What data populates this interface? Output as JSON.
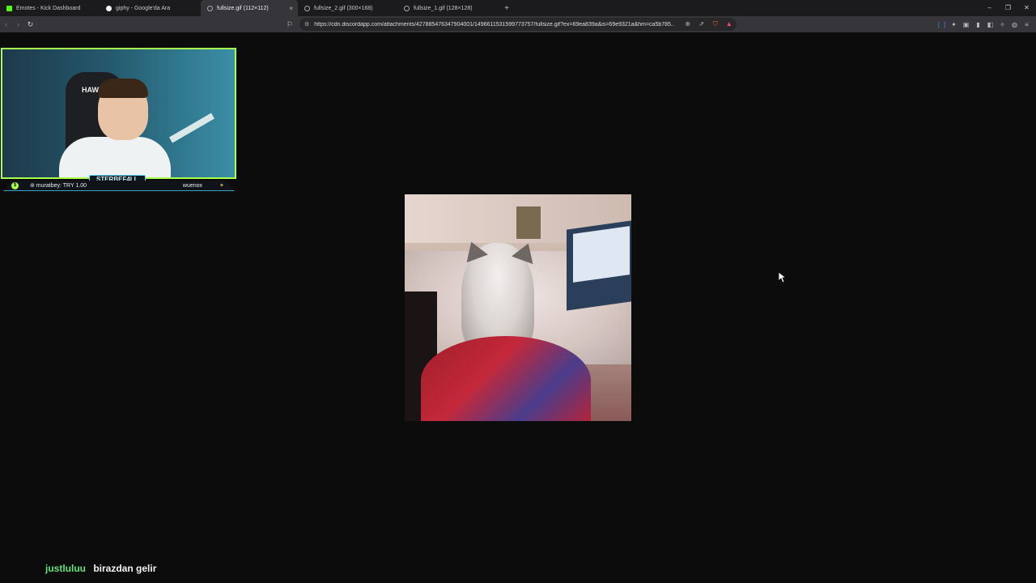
{
  "tabs": [
    {
      "title": "Emotes - Kick Dashboard",
      "favicon": "kick-icon",
      "color": "#53fc18"
    },
    {
      "title": "giphy - Google'da Ara",
      "favicon": "google-icon",
      "color": "#f5f5f5"
    },
    {
      "title": "fullsize.gif (112×112)",
      "favicon": "globe-icon",
      "color": "#aaaaaa",
      "active": true
    },
    {
      "title": "fullsize_2.gif (300×168)",
      "favicon": "globe-icon",
      "color": "#aaaaaa"
    },
    {
      "title": "fullsize_1.gif (128×128)",
      "favicon": "globe-icon",
      "color": "#aaaaaa"
    }
  ],
  "tab_close": "×",
  "new_tab": "+",
  "window": {
    "minimize": "–",
    "maximize": "❐",
    "close": "✕"
  },
  "toolbar": {
    "back": "‹",
    "forward": "›",
    "reload": "↻",
    "bookmark": "⚐",
    "url": "https://cdn.discordapp.com/attachments/427885476347904001/1496611531599773757/fullsize.gif?ex=69ea839a&is=69e9321a&hm=ca5b785..."
  },
  "stream": {
    "cam_label": "STERBEF4LL",
    "coin": "$",
    "donor": "⊚ muratbey: TRY 1.00",
    "username": "wuenox",
    "plus": "+",
    "frame_color": "#a8ff4e",
    "chair_brand": "HAWK"
  },
  "chat": {
    "user": "justluluu",
    "message": "birazdan gelir",
    "user_color": "#5fe27a"
  }
}
